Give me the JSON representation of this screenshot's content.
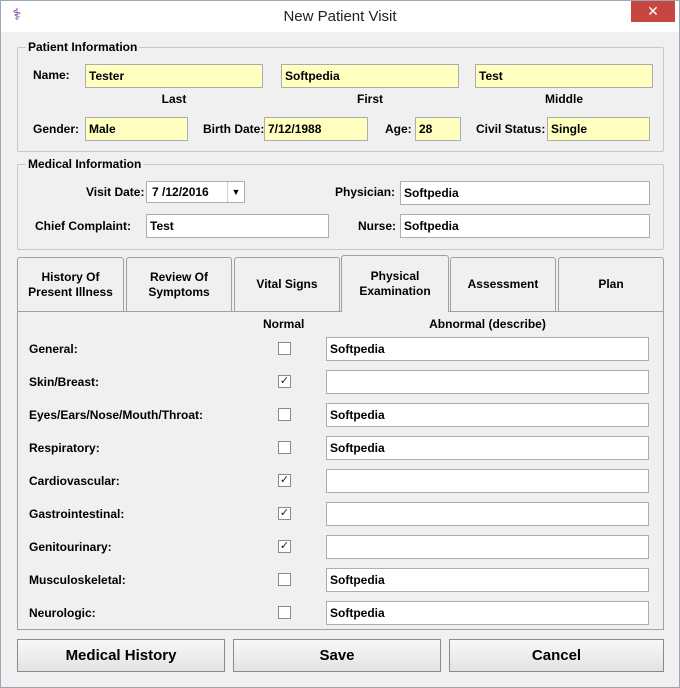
{
  "window": {
    "title": "New Patient Visit",
    "close_glyph": "✕",
    "app_icon": "caduceus-icon"
  },
  "patient": {
    "legend": "Patient Information",
    "name_label": "Name:",
    "last": "Tester",
    "first": "Softpedia",
    "middle": "Test",
    "last_caption": "Last",
    "first_caption": "First",
    "middle_caption": "Middle",
    "gender_label": "Gender:",
    "gender": "Male",
    "birth_label": "Birth Date:",
    "birth": "7/12/1988",
    "age_label": "Age:",
    "age": "28",
    "civil_label": "Civil Status:",
    "civil": "Single"
  },
  "medical": {
    "legend": "Medical Information",
    "visit_label": "Visit Date:",
    "visit": "7 /12/2016",
    "physician_label": "Physician:",
    "physician": "Softpedia",
    "complaint_label": "Chief Complaint:",
    "complaint": "Test",
    "nurse_label": "Nurse:",
    "nurse": "Softpedia"
  },
  "tabs": [
    {
      "line1": "History Of",
      "line2": "Present Illness"
    },
    {
      "line1": "Review Of",
      "line2": "Symptoms"
    },
    {
      "line1": "Vital Signs",
      "line2": ""
    },
    {
      "line1": "Physical",
      "line2": "Examination"
    },
    {
      "line1": "Assessment",
      "line2": ""
    },
    {
      "line1": "Plan",
      "line2": ""
    }
  ],
  "exam": {
    "normal_header": "Normal",
    "abnormal_header": "Abnormal (describe)",
    "rows": [
      {
        "label": "General:",
        "normal": "",
        "abnormal": "Softpedia"
      },
      {
        "label": "Skin/Breast:",
        "normal": "✓",
        "abnormal": ""
      },
      {
        "label": "Eyes/Ears/Nose/Mouth/Throat:",
        "normal": "",
        "abnormal": "Softpedia"
      },
      {
        "label": "Respiratory:",
        "normal": "",
        "abnormal": "Softpedia"
      },
      {
        "label": "Cardiovascular:",
        "normal": "✓",
        "abnormal": ""
      },
      {
        "label": "Gastrointestinal:",
        "normal": "✓",
        "abnormal": ""
      },
      {
        "label": "Genitourinary:",
        "normal": "✓",
        "abnormal": ""
      },
      {
        "label": "Musculoskeletal:",
        "normal": "",
        "abnormal": "Softpedia"
      },
      {
        "label": "Neurologic:",
        "normal": "",
        "abnormal": "Softpedia"
      }
    ]
  },
  "buttons": {
    "history": "Medical History",
    "save": "Save",
    "cancel": "Cancel"
  }
}
